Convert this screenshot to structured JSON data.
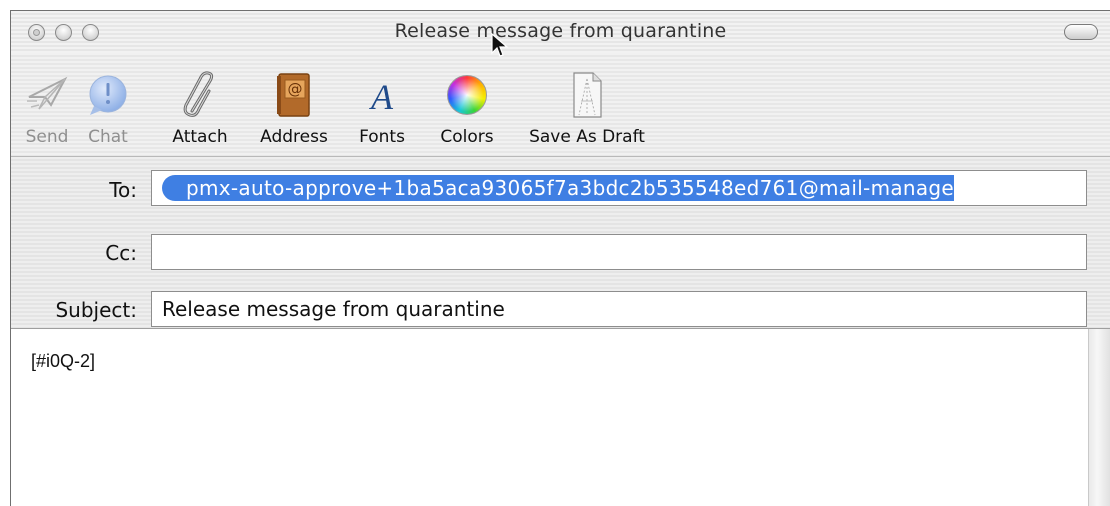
{
  "window": {
    "title": "Release message from quarantine"
  },
  "toolbar": {
    "items": [
      {
        "label": "Send",
        "icon": "paper-plane-icon",
        "enabled": false
      },
      {
        "label": "Chat",
        "icon": "chat-bubble-icon",
        "enabled": false
      },
      {
        "label": "Attach",
        "icon": "paperclip-icon",
        "enabled": true
      },
      {
        "label": "Address",
        "icon": "address-book-icon",
        "enabled": true
      },
      {
        "label": "Fonts",
        "icon": "font-a-icon",
        "enabled": true
      },
      {
        "label": "Colors",
        "icon": "color-wheel-icon",
        "enabled": true
      },
      {
        "label": "Save As Draft",
        "icon": "document-draft-icon",
        "enabled": true
      }
    ]
  },
  "fields": {
    "to_label": "To:",
    "to_value": "pmx-auto-approve+1ba5aca93065f7a3bdc2b535548ed761@mail-manage",
    "cc_label": "Cc:",
    "cc_value": "",
    "subject_label": "Subject:",
    "subject_value": "Release message from quarantine"
  },
  "message": {
    "body": "[#i0Q-2]"
  },
  "colors": {
    "token_blue": "#3f7fe3",
    "window_bg": "#ececec"
  }
}
